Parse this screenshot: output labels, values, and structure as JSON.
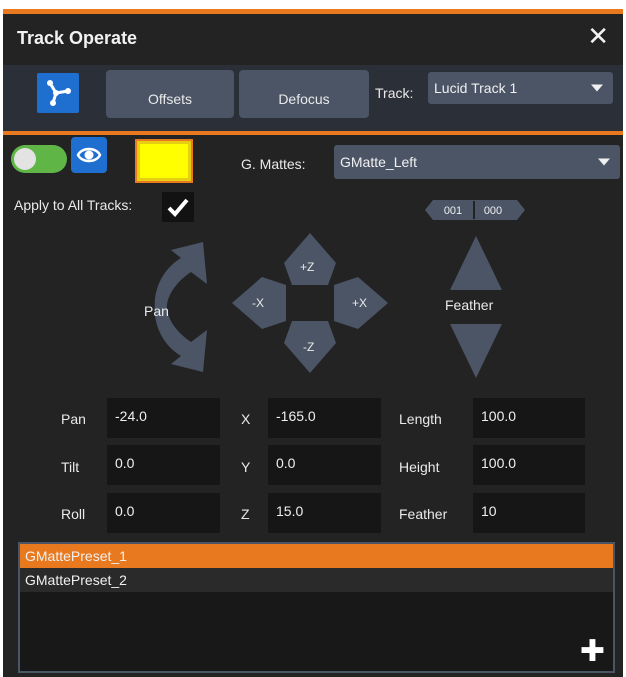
{
  "window": {
    "title": "Track Operate",
    "close_icon": "close-icon"
  },
  "toolbar": {
    "app_icon": "track-node-icon",
    "tabs": [
      {
        "label": "Offsets"
      },
      {
        "label": "Defocus"
      }
    ],
    "track_label": "Track:",
    "track_value": "Lucid Track 1"
  },
  "controls": {
    "toggle_on": true,
    "eye_icon": "eye-icon",
    "swatch_color": "#ffff00",
    "gmattes_label": "G. Mattes:",
    "gmattes_value": "GMatte_Left",
    "apply_label": "Apply to All Tracks:",
    "apply_checked": true,
    "counter": [
      "001",
      "000"
    ]
  },
  "gizmo": {
    "pan_label": "Pan",
    "plus_z": "+Z",
    "minus_z": "-Z",
    "minus_x": "-X",
    "plus_x": "+X",
    "feather_label": "Feather"
  },
  "fields": {
    "pan": {
      "label": "Pan",
      "value": "-24.0"
    },
    "tilt": {
      "label": "Tilt",
      "value": "0.0"
    },
    "roll": {
      "label": "Roll",
      "value": "0.0"
    },
    "x": {
      "label": "X",
      "value": "-165.0"
    },
    "y": {
      "label": "Y",
      "value": "0.0"
    },
    "z": {
      "label": "Z",
      "value": "15.0"
    },
    "length": {
      "label": "Length",
      "value": "100.0"
    },
    "height": {
      "label": "Height",
      "value": "100.0"
    },
    "feather": {
      "label": "Feather",
      "value": "10"
    }
  },
  "presets": {
    "items": [
      "GMattePreset_1",
      "GMattePreset_2"
    ],
    "selected_index": 0,
    "add_icon": "plus-icon"
  },
  "colors": {
    "accent": "#e8791e",
    "primary": "#1f6fd0",
    "toggle": "#5fb646"
  }
}
